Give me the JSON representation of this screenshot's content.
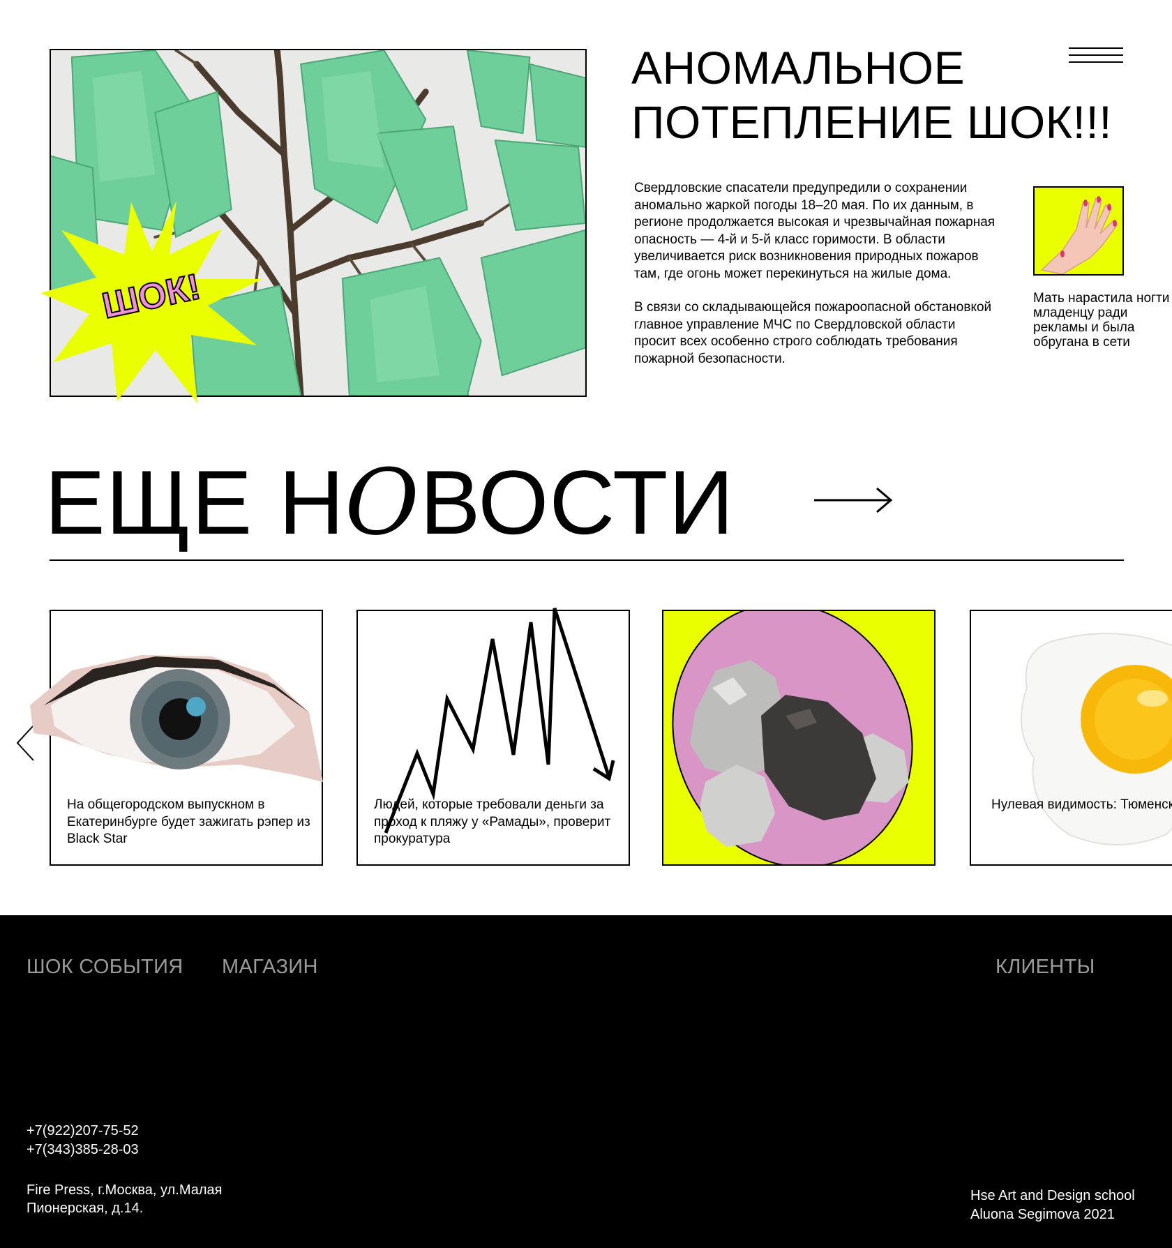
{
  "hero": {
    "title": "АНОМАЛЬНОЕ ПОТЕПЛЕНИЕ ШОК!!!",
    "sticker": "ШОК!",
    "paragraph_1": "Свердловские спасатели предупредили о сохранении аномально жаркой погоды 18–20 мая. По их данным, в регионе продолжается высокая и чрезвычайная пожарная опасность — 4-й и 5-й класс горимости. В области увеличивается риск возникновения природных пожаров там, где огонь может перекинуться на жилые дома.",
    "paragraph_2": "В связи со складывающейся пожароопасной обстановкой главное управление МЧС по Свердловской области просит всех особенно строго соблюдать требования пожарной безопасности.",
    "side_caption": "Мать нарастила ногти младенцу ради рекламы и была обругана в сети"
  },
  "more_news": {
    "title_part1": "ЕЩЕ Н",
    "title_o": "O",
    "title_part2": "ВОСТИ",
    "arrow": "→"
  },
  "cards": [
    {
      "text": "На общегородском выпускном в Екатеринбурге будет зажигать рэпер из Black Star",
      "image": "eye"
    },
    {
      "text": "Людей, которые требовали деньги за проход к пляжу у «Рамады», проверит прокуратура",
      "image": "zigzag-arrow"
    },
    {
      "text": "",
      "image": "stones"
    },
    {
      "text": "Нулевая видимость: Тюменский тракт перекрыли из-за сильного задымления",
      "image": "fried-egg"
    }
  ],
  "footer": {
    "nav": [
      "ШОК СОБЫТИЯ",
      "МАГАЗИН",
      "КЛИЕНТЫ"
    ],
    "phones": [
      "+7(922)207-75-52",
      "+7(343)385-28-03"
    ],
    "address": "Fire Press, г.Москва, ул.Малая Пионерская, д.14.",
    "credits_line1": "Hse Art and Design school",
    "credits_line2": "Aluona Segimova 2021"
  },
  "colors": {
    "accent_yellow": "#eaff00",
    "accent_pink": "#d895c6",
    "sticker_pink": "#f28fd9",
    "bag_green": "#6fcf9a",
    "footer_bg": "#000000",
    "footer_nav": "#9b9b9b"
  },
  "icons": [
    "menu-icon",
    "arrow-right-icon",
    "chevron-left-icon"
  ]
}
